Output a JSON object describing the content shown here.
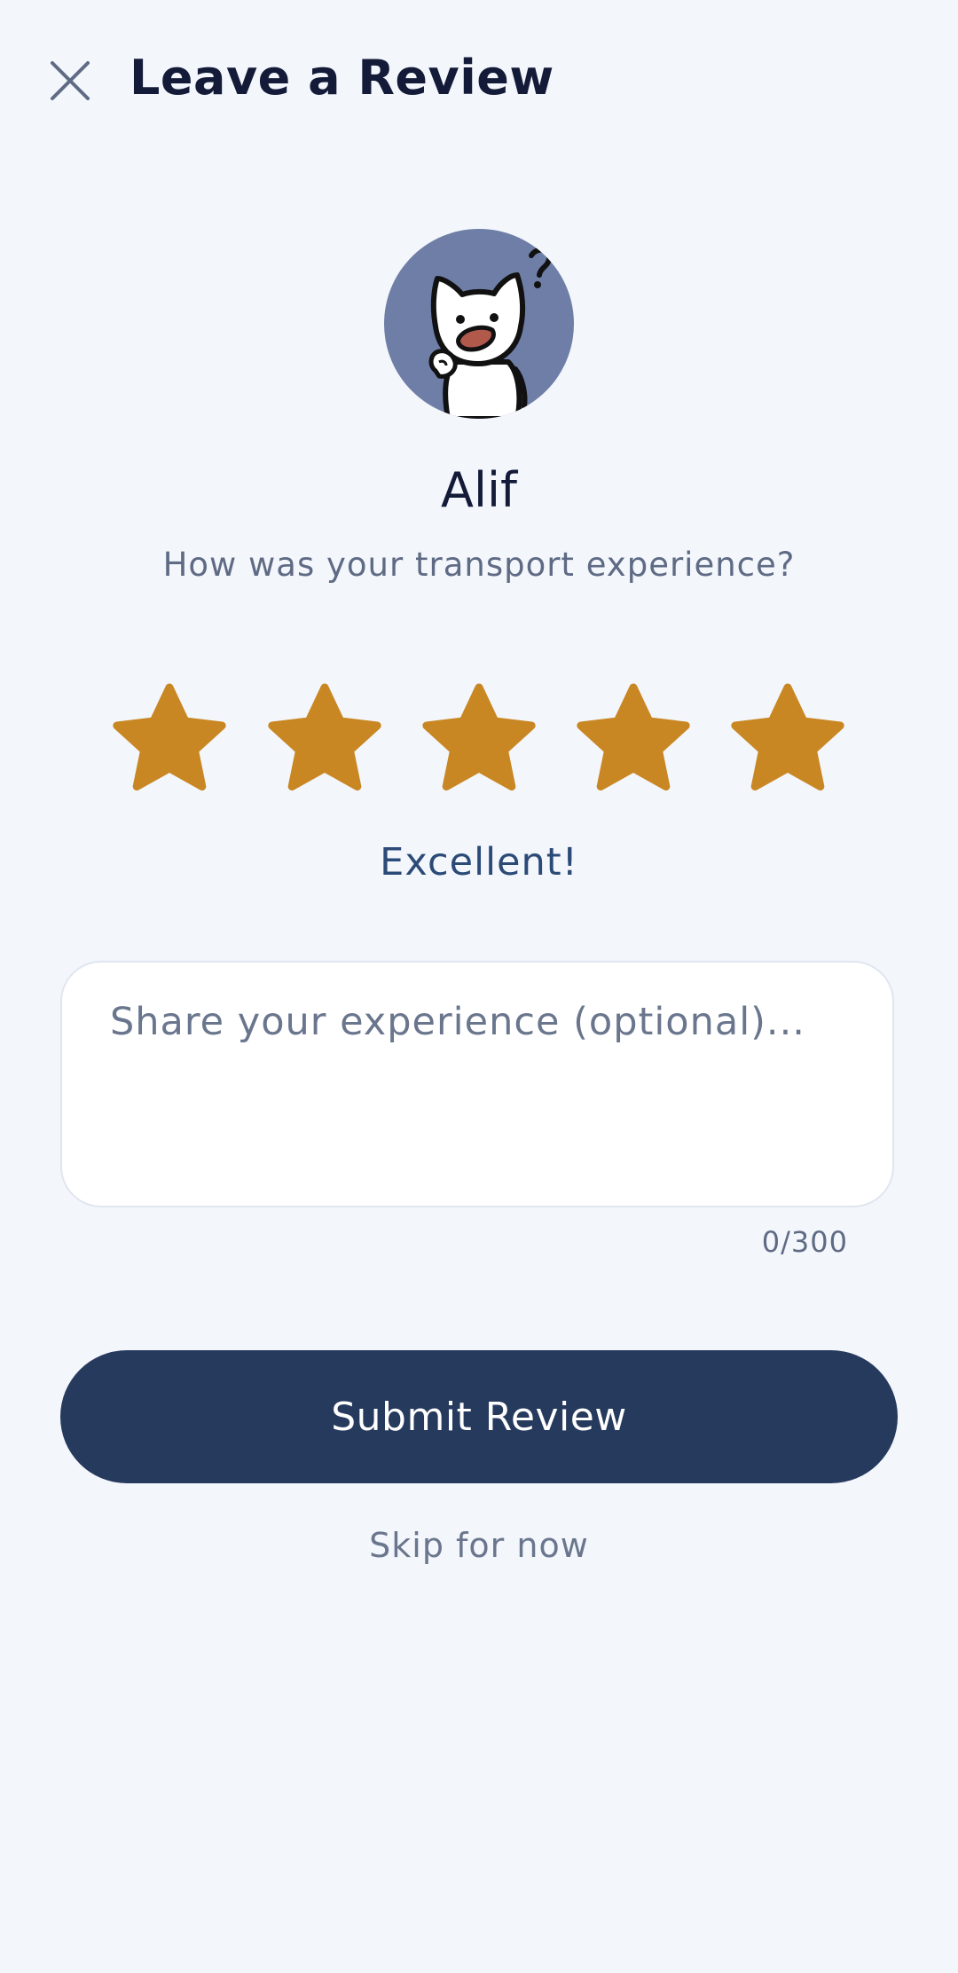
{
  "header": {
    "title": "Leave a Review",
    "close_icon": "close-icon"
  },
  "driver": {
    "name": "Alif",
    "avatar_icon": "cat-avatar-icon"
  },
  "prompt": "How was your transport experience?",
  "rating": {
    "value": 5,
    "max": 5,
    "label": "Excellent!",
    "star_color": "#c98723",
    "icon": "star-icon"
  },
  "review": {
    "value": "",
    "placeholder": "Share your experience (optional)...",
    "char_count": "0/300"
  },
  "actions": {
    "submit_label": "Submit Review",
    "skip_label": "Skip for now"
  },
  "colors": {
    "background": "#f3f6fb",
    "primary": "#263a5e",
    "accent_text": "#2b4a78",
    "avatar_bg": "#6e7ea6"
  }
}
